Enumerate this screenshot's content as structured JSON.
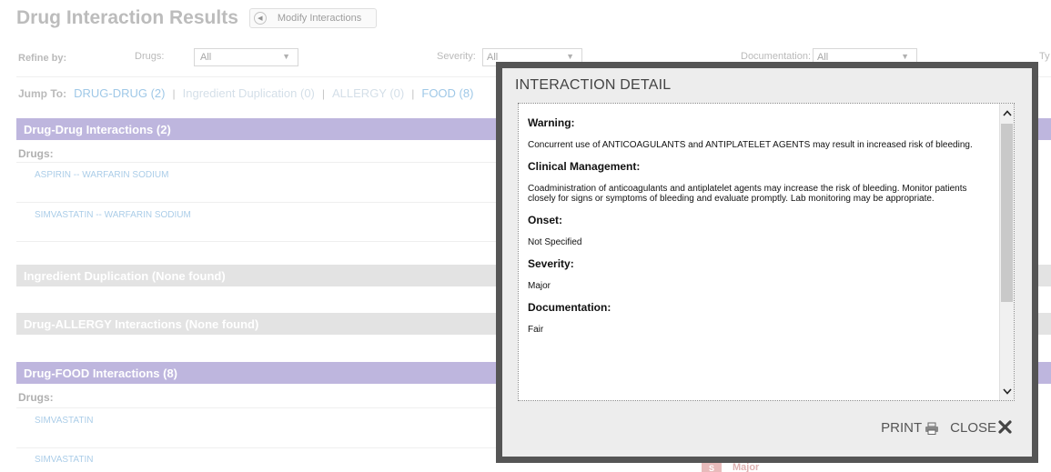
{
  "header": {
    "title": "Drug Interaction Results",
    "modify_label": "Modify Interactions"
  },
  "refine": {
    "label": "Refine by:",
    "drugs_label": "Drugs:",
    "drugs_value": "All",
    "severity_label": "Severity:",
    "severity_value": "All",
    "documentation_label": "Documentation:",
    "documentation_value": "All",
    "type_label_partial": "Ty"
  },
  "jump": {
    "label": "Jump To:",
    "links": [
      "DRUG-DRUG (2)",
      "Ingredient Duplication (0)",
      "ALLERGY (0)",
      "FOOD (8)"
    ],
    "separator": "|"
  },
  "sections": {
    "drug_drug": {
      "title": "Drug-Drug Interactions (2)",
      "drugs_label": "Drugs:",
      "rows": [
        "ASPIRIN -- WARFARIN SODIUM",
        "SIMVASTATIN -- WARFARIN SODIUM"
      ]
    },
    "ingredient": {
      "title": "Ingredient Duplication (None found)"
    },
    "allergy": {
      "title": "Drug-ALLERGY Interactions (None found)"
    },
    "food": {
      "title": "Drug-FOOD Interactions (8)",
      "drugs_label": "Drugs:",
      "rows": [
        "SIMVASTATIN",
        "SIMVASTATIN"
      ],
      "severity_badge": "S",
      "severity_text": "Major"
    }
  },
  "modal": {
    "title": "INTERACTION DETAIL",
    "warning_head": "Warning:",
    "warning_text": "Concurrent use of ANTICOAGULANTS and ANTIPLATELET AGENTS may result in increased risk of bleeding.",
    "management_head": "Clinical Management:",
    "management_text": "Coadministration of anticoagulants and antiplatelet agents may increase the risk of bleeding. Monitor patients closely for signs or symptoms of bleeding and evaluate promptly. Lab monitoring may be appropriate.",
    "onset_head": "Onset:",
    "onset_text": "Not Specified",
    "severity_head": "Severity:",
    "severity_text": "Major",
    "documentation_head": "Documentation:",
    "documentation_text": "Fair",
    "print_label": "PRINT",
    "close_label": "CLOSE"
  },
  "icons": {
    "modify": "left-arrow-circle-icon",
    "print": "printer-icon",
    "close": "close-x-icon",
    "scroll_up": "chevron-up-icon",
    "scroll_down": "chevron-down-icon"
  },
  "colors": {
    "section_purple": "#8f82c6",
    "section_gray": "#cfcfcf",
    "link_blue": "#5aa0d6",
    "modal_border": "#555555"
  }
}
